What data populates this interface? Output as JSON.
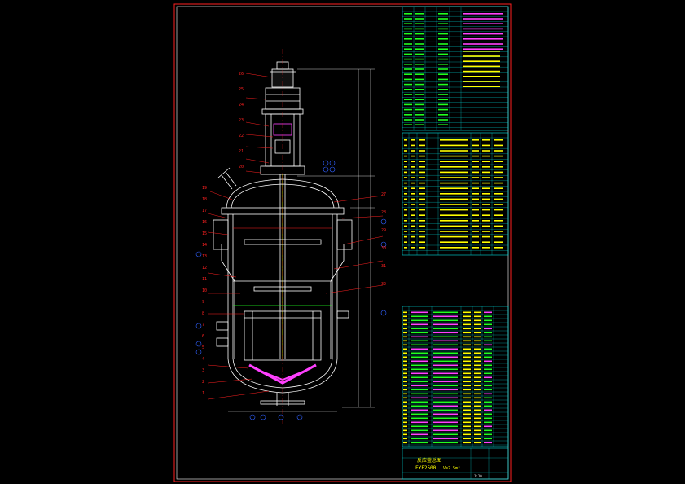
{
  "colors": {
    "background": "#000000",
    "border": "#ff2020",
    "frame": "#ffffff",
    "table_line": "#00e0e0",
    "green": "#20ff20",
    "magenta": "#ff40ff",
    "yellow": "#ffff00",
    "blue": "#3060ff",
    "cyan": "#00ffff",
    "red": "#ff2020"
  },
  "title_block": {
    "name": "反应釜总图",
    "model": "FYF2500",
    "capacity": "V=2.5m³",
    "scale": "1:10"
  },
  "callouts_left": [
    "19",
    "18",
    "17",
    "16",
    "15",
    "14",
    "13",
    "12",
    "11",
    "10",
    "9",
    "8",
    "7",
    "6",
    "5",
    "4",
    "3",
    "2",
    "1"
  ],
  "callouts_top": [
    "26",
    "25",
    "24",
    "23",
    "22",
    "21",
    "20"
  ],
  "callouts_right": [
    "27",
    "28",
    "29",
    "30",
    "31",
    "32"
  ]
}
